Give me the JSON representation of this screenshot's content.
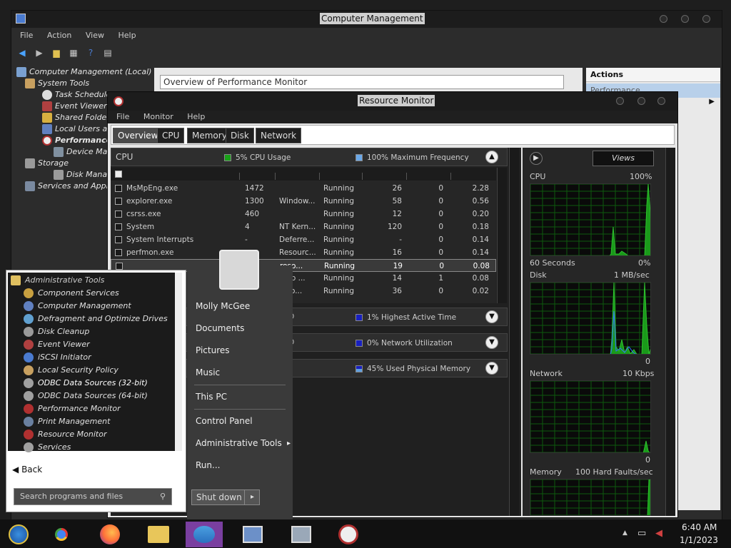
{
  "computer_management": {
    "title": "Computer Management",
    "menu": [
      "File",
      "Action",
      "View",
      "Help"
    ],
    "tree": {
      "root": "Computer Management (Local)",
      "system_tools": "System Tools",
      "task_scheduler": "Task Schedule",
      "event_viewer": "Event Viewer",
      "shared_folders": "Shared Folder",
      "local_users": "Local Users an",
      "performance": "Performance",
      "device_manager": "Device Manag",
      "storage": "Storage",
      "disk_management": "Disk Managen",
      "services_apps": "Services and Appl"
    },
    "overview_text": "Overview of Performance Monitor",
    "actions_title": "Actions",
    "actions_item": "Performance"
  },
  "resource_monitor": {
    "title": "Resource Monitor",
    "menu": [
      "File",
      "Monitor",
      "Help"
    ],
    "tabs": [
      "Overview",
      "CPU",
      "Memory",
      "Disk",
      "Network"
    ],
    "cpu_section": {
      "label": "CPU",
      "usage": "5% CPU Usage",
      "freq": "100% Maximum Frequency"
    },
    "processes": [
      {
        "name": "MsMpEng.exe",
        "pid": "1472",
        "desc": "",
        "status": "Running",
        "threads": "26",
        "cpu": "0",
        "avg": "2.28"
      },
      {
        "name": "explorer.exe",
        "pid": "1300",
        "desc": "Window...",
        "status": "Running",
        "threads": "58",
        "cpu": "0",
        "avg": "0.56"
      },
      {
        "name": "csrss.exe",
        "pid": "460",
        "desc": "",
        "status": "Running",
        "threads": "12",
        "cpu": "0",
        "avg": "0.20"
      },
      {
        "name": "System",
        "pid": "4",
        "desc": "NT Kern...",
        "status": "Running",
        "threads": "120",
        "cpu": "0",
        "avg": "0.18"
      },
      {
        "name": "System Interrupts",
        "pid": "-",
        "desc": "Deferre...",
        "status": "Running",
        "threads": "-",
        "cpu": "0",
        "avg": "0.14"
      },
      {
        "name": "perfmon.exe",
        "pid": "",
        "desc": "Resourc...",
        "status": "Running",
        "threads": "16",
        "cpu": "0",
        "avg": "0.14"
      },
      {
        "name": "",
        "pid": "",
        "desc": "roso...",
        "status": "Running",
        "threads": "19",
        "cpu": "0",
        "avg": "0.08"
      },
      {
        "name": "",
        "pid": "",
        "desc": "ktop ...",
        "status": "Running",
        "threads": "14",
        "cpu": "1",
        "avg": "0.08"
      },
      {
        "name": "",
        "pid": "",
        "desc": "roso...",
        "status": "Running",
        "threads": "36",
        "cpu": "0",
        "avg": "0.02"
      }
    ],
    "disk_section": {
      "label": "O",
      "info": "1% Highest Active Time"
    },
    "network_section": {
      "label": "O",
      "info": "0% Network Utilization"
    },
    "memory_section": {
      "info": "45% Used Physical Memory"
    },
    "views_label": "Views",
    "graphs": {
      "cpu": {
        "label": "CPU",
        "max": "100%",
        "bottom_left": "60 Seconds",
        "bottom_right": "0%"
      },
      "disk": {
        "label": "Disk",
        "max": "1 MB/sec",
        "bottom_right": "0"
      },
      "network": {
        "label": "Network",
        "max": "10 Kbps",
        "bottom_right": "0"
      },
      "memory": {
        "label": "Memory",
        "max": "100 Hard Faults/sec"
      }
    }
  },
  "start_menu": {
    "folder": "Administrative Tools",
    "items": [
      "Component Services",
      "Computer Management",
      "Defragment and Optimize Drives",
      "Disk Cleanup",
      "Event Viewer",
      "iSCSI Initiator",
      "Local Security Policy",
      "ODBC Data Sources (32-bit)",
      "ODBC Data Sources (64-bit)",
      "Performance Monitor",
      "Print Management",
      "Resource Monitor",
      "Services"
    ],
    "back": "Back",
    "search_placeholder": "Search programs and files",
    "right_items": [
      "Molly McGee",
      "Documents",
      "Pictures",
      "Music",
      "This PC",
      "Control Panel",
      "Administrative Tools",
      "Run..."
    ],
    "shutdown": "Shut down"
  },
  "taskbar": {
    "time": "6:40 AM",
    "date": "1/1/2023"
  }
}
